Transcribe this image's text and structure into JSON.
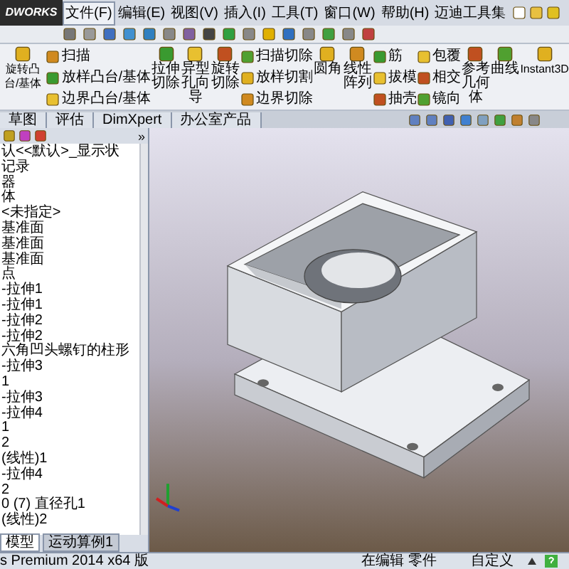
{
  "logo": "DWORKS",
  "menu": [
    {
      "label": "文件(F)",
      "selected": true
    },
    {
      "label": "编辑(E)",
      "selected": false
    },
    {
      "label": "视图(V)",
      "selected": false
    },
    {
      "label": "插入(I)",
      "selected": false
    },
    {
      "label": "工具(T)",
      "selected": false
    },
    {
      "label": "窗口(W)",
      "selected": false
    },
    {
      "label": "帮助(H)",
      "selected": false
    },
    {
      "label": "迈迪工具集",
      "selected": false
    }
  ],
  "ribbon": [
    {
      "kind": "big",
      "label": "旋转凸台/基体"
    },
    {
      "kind": "stack",
      "items": [
        "扫描",
        "放样凸台/基体",
        "边界凸台/基体"
      ]
    },
    {
      "kind": "big",
      "label": "拉伸切除"
    },
    {
      "kind": "big",
      "label": "异型孔向导"
    },
    {
      "kind": "big",
      "label": "旋转切除"
    },
    {
      "kind": "stack",
      "items": [
        "扫描切除",
        "放样切割",
        "边界切除"
      ]
    },
    {
      "kind": "big",
      "label": "圆角"
    },
    {
      "kind": "big",
      "label": "线性阵列"
    },
    {
      "kind": "stack",
      "items": [
        "筋",
        "拔模",
        "抽壳"
      ]
    },
    {
      "kind": "stack",
      "items": [
        "包覆",
        "相交",
        "镜向"
      ]
    },
    {
      "kind": "big",
      "label": "参考几何体"
    },
    {
      "kind": "big",
      "label": "曲线"
    },
    {
      "kind": "big",
      "label": "Instant3D"
    }
  ],
  "command_tabs": [
    "草图",
    "评估",
    "DimXpert",
    "办公室产品"
  ],
  "panel": {
    "more": "»"
  },
  "tree": [
    "认<<默认>_显示状",
    "记录",
    "器",
    "体",
    "<未指定>",
    "基准面",
    "基准面",
    "基准面",
    "点",
    "-拉伸1",
    "-拉伸1",
    "-拉伸2",
    "-拉伸2",
    "六角凹头螺钉的柱形",
    "-拉伸3",
    "1",
    "-拉伸3",
    "-拉伸4",
    "1",
    "2",
    "(线性)1",
    "-拉伸4",
    "2",
    "0 (7) 直径孔1",
    "(线性)2"
  ],
  "bottom_tabs": [
    {
      "label": "模型",
      "selected": true
    },
    {
      "label": "运动算例1",
      "selected": false
    }
  ],
  "status_bar": {
    "product": "s Premium 2014 x64 版",
    "mode": "在编辑 零件",
    "units": "自定义"
  }
}
